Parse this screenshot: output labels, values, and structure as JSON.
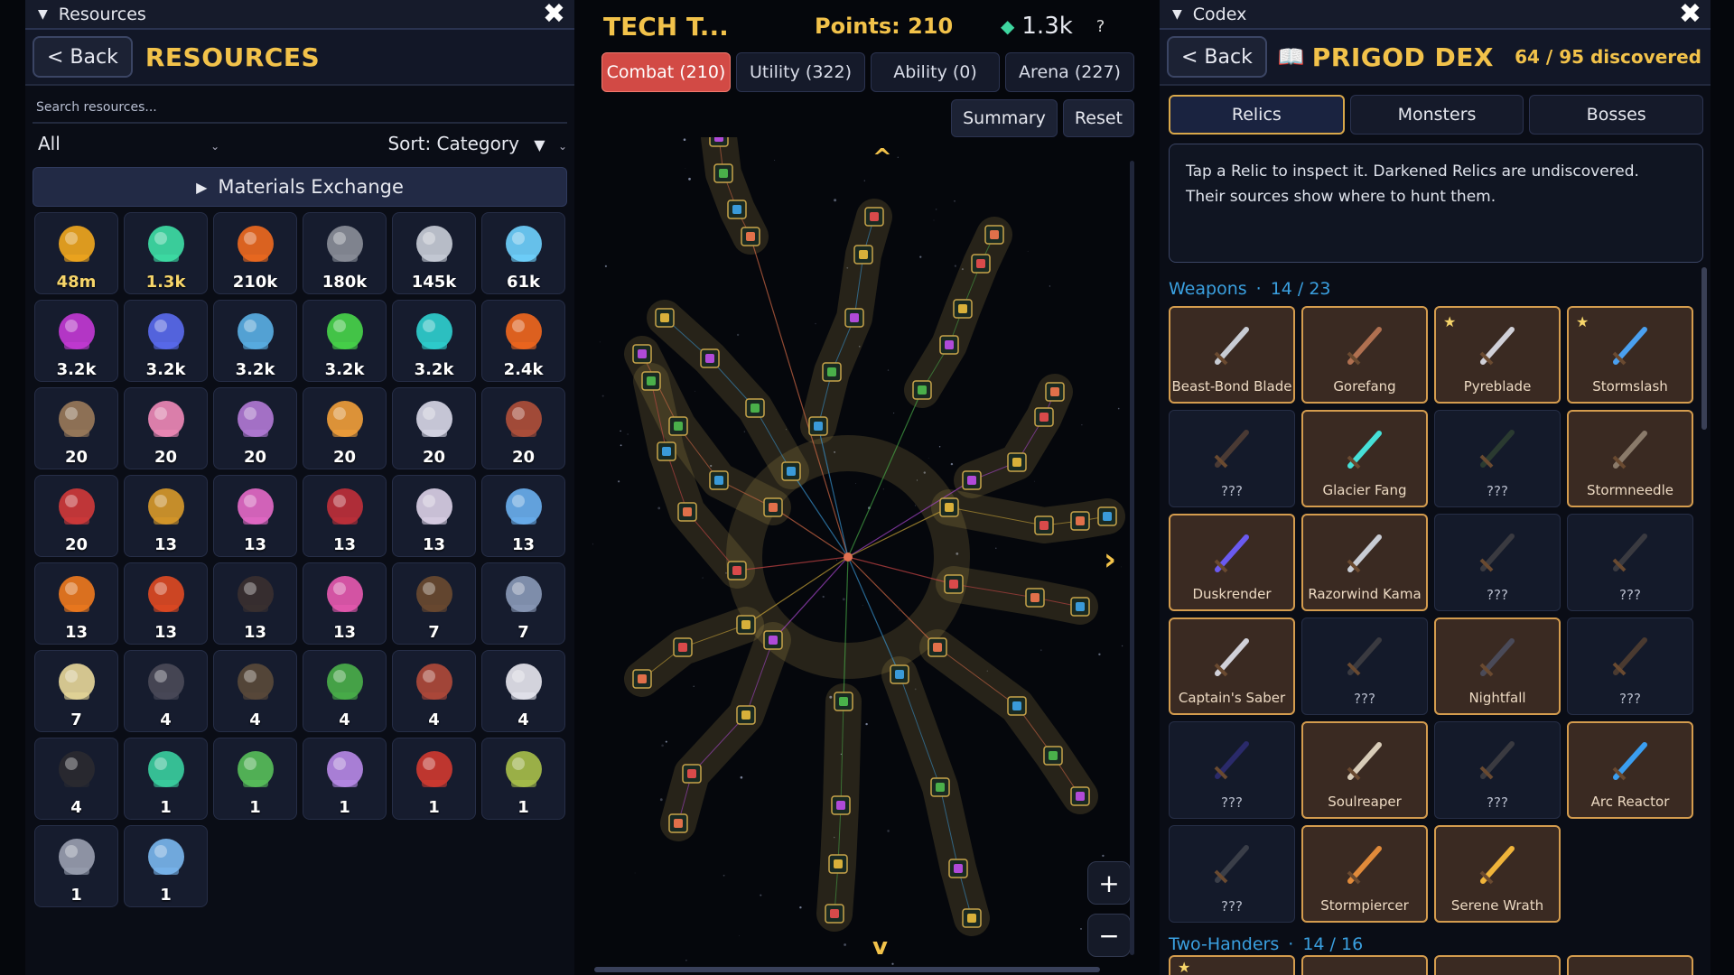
{
  "resources": {
    "window_title": "Resources",
    "back_label": "< Back",
    "title": "RESOURCES",
    "search_placeholder": "Search resources...",
    "filter_value": "All",
    "sort_label": "Sort: Category",
    "exchange_label": "Materials Exchange",
    "items": [
      {
        "icon": "gold-coins-icon",
        "value": "48m",
        "highlight": true,
        "color": "#f2a81e"
      },
      {
        "icon": "emerald-gem-icon",
        "value": "1.3k",
        "highlight": true,
        "color": "#3ee0a6"
      },
      {
        "icon": "wood-log-icon",
        "value": "210k",
        "color": "#ef6a1f"
      },
      {
        "icon": "stone-block-icon",
        "value": "180k",
        "color": "#8b8f99"
      },
      {
        "icon": "iron-ingot-icon",
        "value": "145k",
        "color": "#c9ced8"
      },
      {
        "icon": "crystal-shard-icon",
        "value": "61k",
        "color": "#6fd3ff"
      },
      {
        "icon": "purple-slime-icon",
        "value": "3.2k",
        "color": "#c43ad6"
      },
      {
        "icon": "rocket-icon",
        "value": "3.2k",
        "color": "#5a6cf0"
      },
      {
        "icon": "link-rune-icon",
        "value": "3.2k",
        "color": "#5ab0e6"
      },
      {
        "icon": "green-cauldron-icon",
        "value": "3.2k",
        "color": "#48d64a"
      },
      {
        "icon": "cyan-orb-icon",
        "value": "3.2k",
        "color": "#2fd2d0"
      },
      {
        "icon": "fire-ore-icon",
        "value": "2.4k",
        "color": "#f2681e"
      },
      {
        "icon": "knight-hero-icon",
        "value": "20",
        "color": "#9a7a5a"
      },
      {
        "icon": "cupid-hero-icon",
        "value": "20",
        "color": "#f08ab8"
      },
      {
        "icon": "wizard-hero-icon",
        "value": "20",
        "color": "#b27ad6"
      },
      {
        "icon": "monk-hero-icon",
        "value": "20",
        "color": "#f2a03a"
      },
      {
        "icon": "valkyrie-hero-icon",
        "value": "20",
        "color": "#d8d8e8"
      },
      {
        "icon": "berserker-hero-icon",
        "value": "20",
        "color": "#b0503a"
      },
      {
        "icon": "assassin-hero-icon",
        "value": "20",
        "color": "#d23a3a"
      },
      {
        "icon": "golem-hero-icon",
        "value": "13",
        "color": "#d89a2a"
      },
      {
        "icon": "sorceress-hero-icon",
        "value": "13",
        "color": "#e66ac8"
      },
      {
        "icon": "demon-hero-icon",
        "value": "13",
        "color": "#c0303a"
      },
      {
        "icon": "bunny-hero-icon",
        "value": "13",
        "color": "#dcd2e8"
      },
      {
        "icon": "mage-hero-icon",
        "value": "13",
        "color": "#6ab0f0"
      },
      {
        "icon": "pumpkin-hero-icon",
        "value": "13",
        "color": "#f07a1e"
      },
      {
        "icon": "dragon-hero-icon",
        "value": "13",
        "color": "#e04a22"
      },
      {
        "icon": "jackal-hero-icon",
        "value": "13",
        "color": "#3a3030"
      },
      {
        "icon": "fairy-hero-icon",
        "value": "13",
        "color": "#e85ab0"
      },
      {
        "icon": "ninja-hero-icon",
        "value": "7",
        "color": "#6a4a30"
      },
      {
        "icon": "paladin-hero-icon",
        "value": "7",
        "color": "#8a9ab8"
      },
      {
        "icon": "angel-hero-icon",
        "value": "7",
        "color": "#e8d89a"
      },
      {
        "icon": "shadow-hero-icon",
        "value": "4",
        "color": "#4a4a58"
      },
      {
        "icon": "pirate-hero-icon",
        "value": "4",
        "color": "#5a4a3a"
      },
      {
        "icon": "zombie-hero-icon",
        "value": "4",
        "color": "#4ab04a"
      },
      {
        "icon": "bandit-hero-icon",
        "value": "4",
        "color": "#b04a3a"
      },
      {
        "icon": "yeti-hero-icon",
        "value": "4",
        "color": "#e8e8f0"
      },
      {
        "icon": "reaper-hero-icon",
        "value": "4",
        "color": "#2a2a30"
      },
      {
        "icon": "oni-hero-icon",
        "value": "1",
        "color": "#3ad0a0"
      },
      {
        "icon": "goblin-hero-icon",
        "value": "1",
        "color": "#58c05a"
      },
      {
        "icon": "wisp-hero-icon",
        "value": "1",
        "color": "#b88ae8"
      },
      {
        "icon": "red-hood-hero-icon",
        "value": "1",
        "color": "#d03a30"
      },
      {
        "icon": "archer-hero-icon",
        "value": "1",
        "color": "#a8c04a"
      },
      {
        "icon": "armored-knight-hero-icon",
        "value": "1",
        "color": "#9aa0b0"
      },
      {
        "icon": "frost-angel-hero-icon",
        "value": "1",
        "color": "#7ab8f0"
      }
    ]
  },
  "tech": {
    "title": "TECH T...",
    "points": "Points: 210",
    "gems": "1.3k",
    "help": "?",
    "tabs": [
      "Combat (210)",
      "Utility (322)",
      "Ability (0)",
      "Arena (227)"
    ],
    "active_tab": "Combat (210)",
    "summary_label": "Summary",
    "reset_label": "Reset",
    "zoom_in": "+",
    "zoom_out": "−",
    "up_arrow": "^",
    "down_arrow": "v",
    "right_arrow": "›"
  },
  "codex": {
    "window_title": "Codex",
    "back_label": "< Back",
    "title": "PRIGOD DEX",
    "discovered": "64 / 95 discovered",
    "tabs": [
      "Relics",
      "Monsters",
      "Bosses"
    ],
    "active_tab": "Relics",
    "info_text_1": "Tap a Relic to inspect it. Darkened Relics are undiscovered.",
    "info_text_2": "Their sources show where to hunt them.",
    "section_weapons": "Weapons",
    "section_weapons_count": "14 / 23",
    "section_twohanders": "Two-Handers",
    "section_twohanders_count": "14 / 16",
    "relics": [
      {
        "name": "Beast-Bond Blade",
        "found": true,
        "star": false,
        "color": "#c8ccd4"
      },
      {
        "name": "Gorefang",
        "found": true,
        "star": false,
        "color": "#b07050"
      },
      {
        "name": "Pyreblade",
        "found": true,
        "star": true,
        "color": "#d0d0d8"
      },
      {
        "name": "Stormslash",
        "found": true,
        "star": true,
        "color": "#4aa0f0"
      },
      {
        "name": "???",
        "found": false,
        "star": false,
        "color": "#4a3a34"
      },
      {
        "name": "Glacier Fang",
        "found": true,
        "star": false,
        "color": "#46e0d8"
      },
      {
        "name": "???",
        "found": false,
        "star": false,
        "color": "#2a3a30"
      },
      {
        "name": "Stormneedle",
        "found": true,
        "star": false,
        "color": "#8a7a6a"
      },
      {
        "name": "Duskrender",
        "found": true,
        "star": false,
        "color": "#6a5af0"
      },
      {
        "name": "Razorwind Kama",
        "found": true,
        "star": false,
        "color": "#c8ccd4"
      },
      {
        "name": "???",
        "found": false,
        "star": false,
        "color": "#3a3a40"
      },
      {
        "name": "???",
        "found": false,
        "star": false,
        "color": "#3a3a40"
      },
      {
        "name": "Captain's Saber",
        "found": true,
        "star": false,
        "color": "#d0d0d8"
      },
      {
        "name": "???",
        "found": false,
        "star": false,
        "color": "#3a3a40"
      },
      {
        "name": "Nightfall",
        "found": true,
        "star": false,
        "color": "#4a4a58"
      },
      {
        "name": "???",
        "found": false,
        "star": false,
        "color": "#4a3a30"
      },
      {
        "name": "???",
        "found": false,
        "star": false,
        "color": "#2a2a6a"
      },
      {
        "name": "Soulreaper",
        "found": true,
        "star": false,
        "color": "#d8ccb8"
      },
      {
        "name": "???",
        "found": false,
        "star": false,
        "color": "#3a3a40"
      },
      {
        "name": "Arc Reactor",
        "found": true,
        "star": false,
        "color": "#3a9ef0"
      },
      {
        "name": "???",
        "found": false,
        "star": false,
        "color": "#3a3e48"
      },
      {
        "name": "Stormpiercer",
        "found": true,
        "star": false,
        "color": "#e08a3a"
      },
      {
        "name": "Serene Wrath",
        "found": true,
        "star": false,
        "color": "#f0b43a"
      }
    ]
  }
}
